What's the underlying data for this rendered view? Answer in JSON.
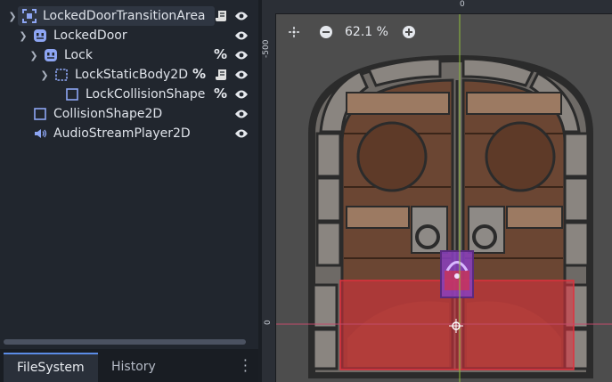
{
  "scene_tree": {
    "nodes": [
      {
        "name": "LockedDoorTransitionArea",
        "icon": "area2d-icon"
      },
      {
        "name": "LockedDoor",
        "icon": "sprite-icon"
      },
      {
        "name": "Lock",
        "icon": "sprite-icon"
      },
      {
        "name": "LockStaticBody2D",
        "icon": "static-body-icon"
      },
      {
        "name": "LockCollisionShape",
        "icon": "collision-shape-icon"
      },
      {
        "name": "CollisionShape2D",
        "icon": "collision-shape-icon"
      },
      {
        "name": "AudioStreamPlayer2D",
        "icon": "audio-icon"
      }
    ],
    "pct_glyph": "%"
  },
  "dock": {
    "tabs": [
      "FileSystem",
      "History"
    ],
    "menu_glyph": "⋮"
  },
  "viewport": {
    "zoom_label": "62.1 %",
    "ruler_top_label": "0",
    "ruler_left_labels": [
      "-500",
      "0"
    ]
  },
  "colors": {
    "accent": "#5b8ce6",
    "collision_fill": "#e0303c",
    "lock_purple": "#8a3fc0",
    "axis_green": "#8fbf3a",
    "axis_red": "#c24a6b"
  }
}
